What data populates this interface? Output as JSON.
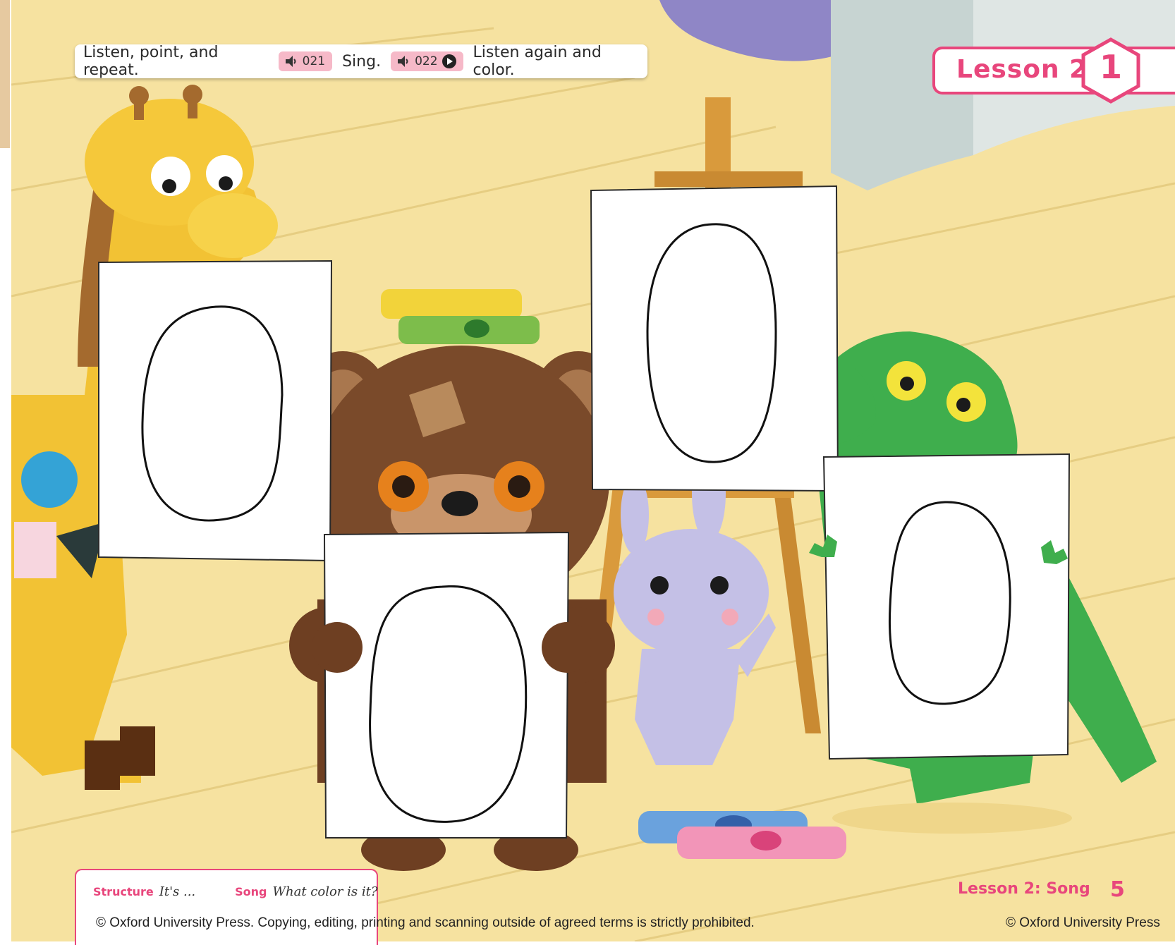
{
  "instructions": {
    "step1": "Listen, point, and repeat.",
    "audio1": "021",
    "step2": "Sing.",
    "audio2": "022",
    "step3": "Listen again and color."
  },
  "lesson": {
    "label": "Lesson 2",
    "unit": "1"
  },
  "info": {
    "structure_label": "Structure",
    "structure_text": "It's ...",
    "song_label": "Song",
    "song_text": "What color is it?"
  },
  "footer": {
    "title": "Lesson 2: Song",
    "page": "5",
    "copyright": "© Oxford University Press. Copying, editing, printing and scanning outside of agreed terms is strictly prohibited.",
    "copyright_right": "© Oxford University Press"
  },
  "colors": {
    "accent": "#e8467c",
    "floor": "#f6e3a3",
    "wall": "#f4d99a"
  }
}
